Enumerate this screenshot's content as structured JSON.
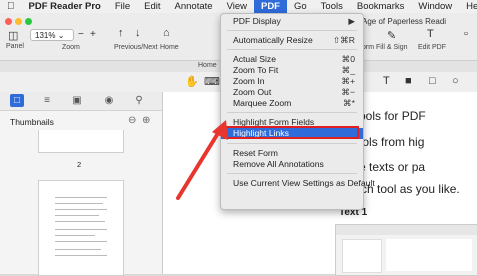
{
  "menubar": {
    "apple": "",
    "items": [
      "PDF Reader Pro",
      "File",
      "Edit",
      "Annotate",
      "View",
      "PDF",
      "Go",
      "Tools",
      "Bookmarks",
      "Window",
      "Help"
    ]
  },
  "toolbar": {
    "zoom_value": "131%",
    "panel_label": "Panel",
    "zoom_label": "Zoom",
    "prevnext_label": "Previous/Next",
    "home_label": "Home",
    "form_label": "orm",
    "fill_sign_label": "Fill & Sign",
    "edit_pdf_label": "Edit PDF",
    "doc_title": "Age of Paperless Readi",
    "tab_home": "Home"
  },
  "sidebar": {
    "title": "Thumbnails",
    "page_number": "2"
  },
  "document": {
    "line1": "verse tools for PDF",
    "line2": "ation tools from hig",
    "line3": "k up the texts or pa",
    "line4": "color of each tool as you like.",
    "heading": "Text 1"
  },
  "menu": {
    "items": [
      {
        "label": "PDF Display",
        "shortcut": "▶"
      },
      {
        "label": "Automatically Resize",
        "shortcut": "⇧⌘R"
      },
      {
        "label": "Actual Size",
        "shortcut": "⌘0"
      },
      {
        "label": "Zoom To Fit",
        "shortcut": "⌘_"
      },
      {
        "label": "Zoom In",
        "shortcut": "⌘+"
      },
      {
        "label": "Zoom Out",
        "shortcut": "⌘−"
      },
      {
        "label": "Marquee Zoom",
        "shortcut": "⌘*"
      },
      {
        "label": "Highlight Form Fields",
        "shortcut": ""
      },
      {
        "label": "Highlight Links",
        "shortcut": ""
      },
      {
        "label": "Reset Form",
        "shortcut": ""
      },
      {
        "label": "Remove All Annotations",
        "shortcut": ""
      },
      {
        "label": "Use Current View Settings as Default",
        "shortcut": ""
      }
    ]
  },
  "colors": {
    "accent": "#2f6bd9",
    "arrow": "#e8362e",
    "highlight_box": "#e02020"
  }
}
